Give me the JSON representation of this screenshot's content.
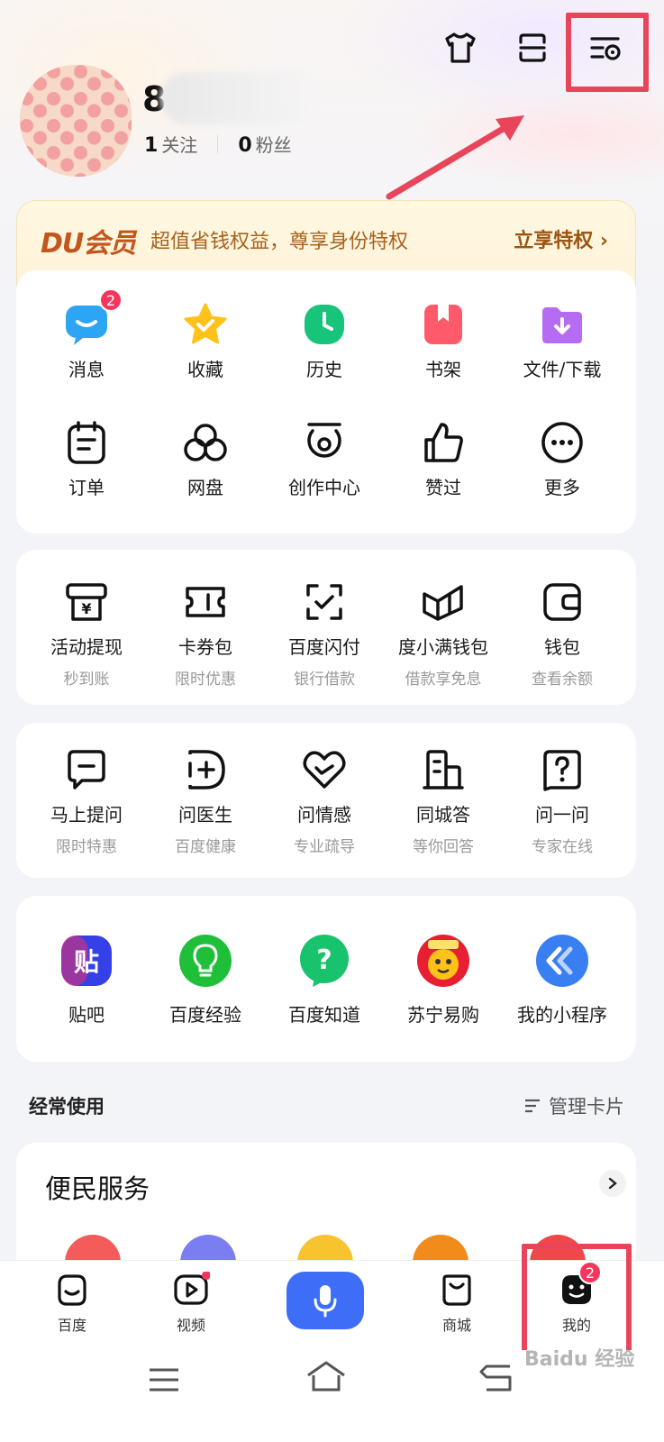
{
  "header": {
    "icons": [
      "tshirt-icon",
      "scan-icon",
      "settings-icon"
    ]
  },
  "profile": {
    "name_initial": "8",
    "following_count": "1",
    "following_label": "关注",
    "fans_count": "0",
    "fans_label": "粉丝"
  },
  "vip": {
    "logo": "DU会员",
    "text": "超值省钱权益，尊享身份特权",
    "button": "立享特权 ›"
  },
  "quick": [
    {
      "label": "消息",
      "icon": "message-icon",
      "badge": "2"
    },
    {
      "label": "收藏",
      "icon": "star-icon"
    },
    {
      "label": "历史",
      "icon": "clock-icon"
    },
    {
      "label": "书架",
      "icon": "bookmark-icon"
    },
    {
      "label": "文件/下载",
      "icon": "download-folder-icon"
    },
    {
      "label": "订单",
      "icon": "order-icon"
    },
    {
      "label": "网盘",
      "icon": "cloud-disk-icon"
    },
    {
      "label": "创作中心",
      "icon": "creator-icon"
    },
    {
      "label": "赞过",
      "icon": "thumbs-up-icon"
    },
    {
      "label": "更多",
      "icon": "more-icon"
    }
  ],
  "finance": [
    {
      "label": "活动提现",
      "sub": "秒到账",
      "icon": "cash-withdraw-icon"
    },
    {
      "label": "卡券包",
      "sub": "限时优惠",
      "icon": "coupon-icon"
    },
    {
      "label": "百度闪付",
      "sub": "银行借款",
      "icon": "flash-pay-icon"
    },
    {
      "label": "度小满钱包",
      "sub": "借款享免息",
      "icon": "wallet-brand-icon"
    },
    {
      "label": "钱包",
      "sub": "查看余额",
      "icon": "wallet-icon"
    }
  ],
  "ask": [
    {
      "label": "马上提问",
      "sub": "限时特惠",
      "icon": "ask-now-icon"
    },
    {
      "label": "问医生",
      "sub": "百度健康",
      "icon": "doctor-icon"
    },
    {
      "label": "问情感",
      "sub": "专业疏导",
      "icon": "heart-chat-icon"
    },
    {
      "label": "同城答",
      "sub": "等你回答",
      "icon": "building-icon"
    },
    {
      "label": "问一问",
      "sub": "专家在线",
      "icon": "question-bubble-icon"
    }
  ],
  "apps": [
    {
      "label": "贴吧",
      "icon": "tieba-icon",
      "color": "#3b4cf0"
    },
    {
      "label": "百度经验",
      "icon": "bulb-icon",
      "color": "#1fbf3a"
    },
    {
      "label": "百度知道",
      "icon": "question-icon",
      "color": "#19c26c"
    },
    {
      "label": "苏宁易购",
      "icon": "suning-icon",
      "color": "#f6a100"
    },
    {
      "label": "我的小程序",
      "icon": "mini-program-icon",
      "color": "#3a7ff2"
    }
  ],
  "frequent": {
    "title": "经常使用",
    "manage": "管理卡片"
  },
  "services": {
    "title": "便民服务"
  },
  "tabs": [
    {
      "label": "百度",
      "icon": "baidu-home-icon"
    },
    {
      "label": "视频",
      "icon": "video-icon"
    },
    {
      "label": "",
      "icon": "mic-icon"
    },
    {
      "label": "商城",
      "icon": "shop-bag-icon"
    },
    {
      "label": "我的",
      "icon": "my-face-icon",
      "badge": "2"
    }
  ],
  "watermark": "Baidu 经验",
  "colors": {
    "accent": "#3e6df8",
    "badge": "#f3365b",
    "highlight": "#e8455a",
    "vip": "#c2561c"
  }
}
